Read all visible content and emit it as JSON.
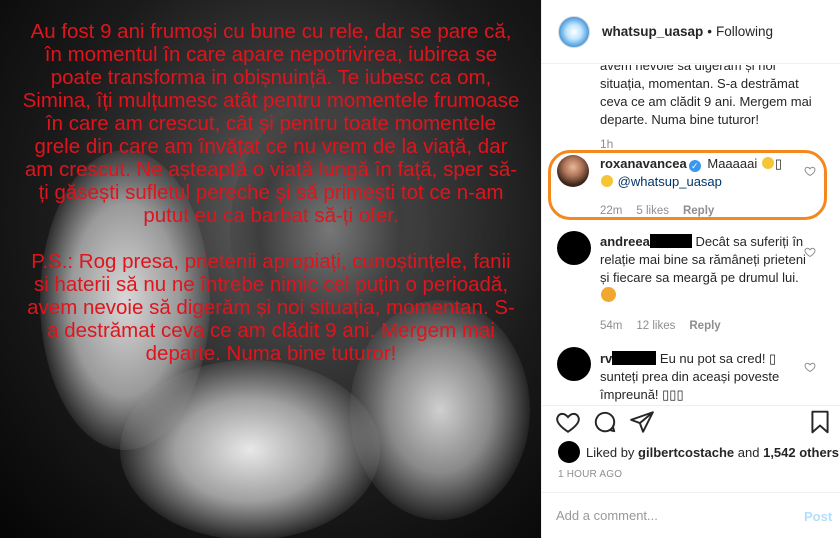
{
  "image": {
    "overlay_text": "Au fost 9 ani frumoși cu bune cu rele, dar se pare că, în momentul în care apare nepotrivirea, iubirea se poate transforma in obișnuință. Te iubesc ca om, Simina, îți mulțumesc atât pentru momentele frumoase în care am crescut, cât și pentru toate momentele grele din care am învățat ce nu vrem de la viață, dar am crescut. Ne așteaptă o viață lungă în față, sper să-ți găsești sufletul pereche și să primești tot ce n-am putut eu ca barbat să-ți ofer.\n\nP.S.: Rog presa, prietenii apropiați, cunoștințele, fanii si haterii să nu ne întrebe nimic cel puțin o perioadă, avem nevoie să digerăm și noi situația, momentan. S-a destrămat ceva ce am clădit 9 ani. Mergem mai departe. Numa bine tuturor!"
  },
  "header": {
    "username": "whatsup_uasap",
    "separator": "•",
    "follow_status": "Following"
  },
  "caption": {
    "fragment": "avem nevoie să digerăm și noi situația, momentan. S-a destrămat ceva ce am clădit 9 ani. Mergem mai departe. Numa bine tuturor!",
    "time": "1h"
  },
  "comments": [
    {
      "username": "roxanavancea",
      "verified_mark": "✓",
      "text": "Maaaaai",
      "mention": "@whatsup_uasap",
      "time": "22m",
      "likes": "5 likes",
      "reply": "Reply"
    },
    {
      "username": "andreea",
      "text": "Decât sa suferiți în relație mai bine sa rămâneți prieteni și fiecare sa meargă pe drumul lui.",
      "time": "54m",
      "likes": "12 likes",
      "reply": "Reply"
    },
    {
      "username": "rv",
      "text": "Eu nu pot sa cred! ▯ sunteți prea din aceași poveste împreună! ▯▯▯"
    }
  ],
  "likes": {
    "prefix": "Liked by",
    "user": "gilbertcostache",
    "middle": "and",
    "count": "1,542 others"
  },
  "time_ago": "1 HOUR AGO",
  "add_comment": {
    "placeholder": "Add a comment...",
    "post": "Post"
  },
  "colors": {
    "overlay_text": "#e0141c",
    "highlight_ring": "#f5871f",
    "verified": "#3897f0",
    "post_disabled": "#b2dffc"
  },
  "icons": [
    "heart-icon",
    "comment-icon",
    "share-icon",
    "bookmark-icon",
    "verified-icon"
  ]
}
